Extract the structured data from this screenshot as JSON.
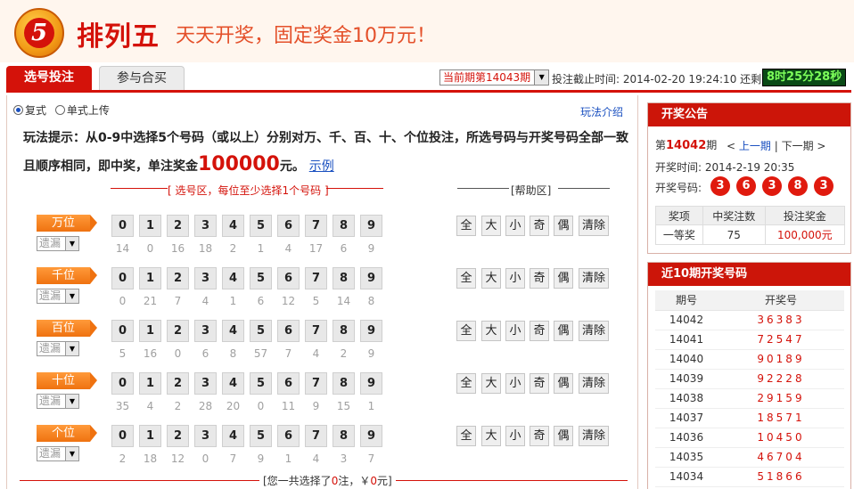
{
  "header": {
    "logo_glyph": "5",
    "title": "排列五",
    "slogan": "天天开奖，固定奖金10万元！"
  },
  "tabs": [
    {
      "label": "选号投注",
      "active": true
    },
    {
      "label": "参与合买",
      "active": false
    }
  ],
  "period": {
    "select_value": "当前期第14043期",
    "deadline_label": "投注截止时间:",
    "deadline_value": "2014-02-20 19:24:10",
    "remain_label": "还剩:",
    "countdown": "8时25分28秒"
  },
  "mode": {
    "compound": "复式",
    "single_upload": "单式上传",
    "selected": "复式",
    "rules_link": "玩法介绍"
  },
  "hint": {
    "text_before": "玩法提示：从0-9中选择5个号码（或以上）分别对万、千、百、十、个位投注，所选号码与开奖号码全部一致且顺序相同，即中奖，单注奖金",
    "prize": "100000",
    "unit": "元。",
    "example_link": "示例"
  },
  "select_area": {
    "title": "[ 选号区，每位至少选择1个号码 ]",
    "help_title": "[帮助区]",
    "omit_label": "遗漏",
    "digits": [
      "0",
      "1",
      "2",
      "3",
      "4",
      "5",
      "6",
      "7",
      "8",
      "9"
    ],
    "help_buttons": [
      "全",
      "大",
      "小",
      "奇",
      "偶",
      "清除"
    ],
    "rows": [
      {
        "position": "万位",
        "misses": [
          "14",
          "0",
          "16",
          "18",
          "2",
          "1",
          "4",
          "17",
          "6",
          "9"
        ]
      },
      {
        "position": "千位",
        "misses": [
          "0",
          "21",
          "7",
          "4",
          "1",
          "6",
          "12",
          "5",
          "14",
          "8"
        ]
      },
      {
        "position": "百位",
        "misses": [
          "5",
          "16",
          "0",
          "6",
          "8",
          "57",
          "7",
          "4",
          "2",
          "9"
        ]
      },
      {
        "position": "十位",
        "misses": [
          "35",
          "4",
          "2",
          "28",
          "20",
          "0",
          "11",
          "9",
          "15",
          "1"
        ]
      },
      {
        "position": "个位",
        "misses": [
          "2",
          "18",
          "12",
          "0",
          "7",
          "9",
          "1",
          "4",
          "3",
          "7"
        ]
      }
    ]
  },
  "summary": {
    "prefix": "[您一共选择了",
    "count": "0",
    "mid": "注，￥",
    "amount": "0",
    "suffix": "元]"
  },
  "draw_notice": {
    "title": "开奖公告",
    "period_prefix": "第",
    "period": "14042",
    "period_suffix": "期",
    "prev_link": "上一期",
    "next_link": "下一期",
    "time_label": "开奖时间:",
    "time_value": "2014-2-19 20:35",
    "numbers_label": "开奖号码:",
    "numbers": [
      "3",
      "6",
      "3",
      "8",
      "3"
    ],
    "table_headers": [
      "奖项",
      "中奖注数",
      "投注奖金"
    ],
    "table_rows": [
      [
        "一等奖",
        "75",
        "100,000元"
      ]
    ]
  },
  "recent": {
    "title": "近10期开奖号码",
    "headers": [
      "期号",
      "开奖号"
    ],
    "rows": [
      [
        "14042",
        "36383"
      ],
      [
        "14041",
        "72547"
      ],
      [
        "14040",
        "90189"
      ],
      [
        "14039",
        "92228"
      ],
      [
        "14038",
        "29159"
      ],
      [
        "14037",
        "18571"
      ],
      [
        "14036",
        "10450"
      ],
      [
        "14035",
        "46704"
      ],
      [
        "14034",
        "51866"
      ]
    ]
  },
  "colors": {
    "brand_red": "#d4120a",
    "accent_orange": "#ef7210",
    "countdown_green": "#7dff5a",
    "link_blue": "#1a50c0"
  }
}
